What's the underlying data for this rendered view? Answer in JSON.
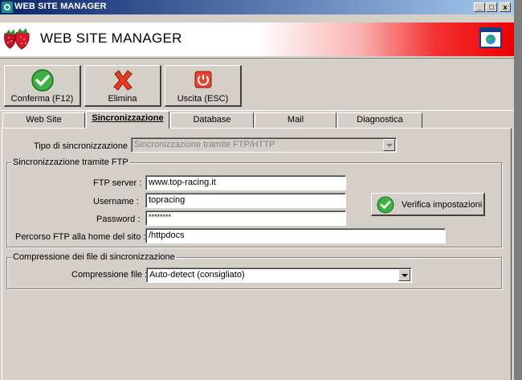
{
  "window": {
    "title": "WEB SITE MANAGER",
    "min_glyph": "_",
    "max_glyph": "□",
    "close_glyph": "x"
  },
  "header": {
    "title": "WEB SITE MANAGER"
  },
  "toolbar": {
    "confirm_label": "Conferma (F12)",
    "delete_label": "Elimina",
    "exit_label": "Uscita (ESC)"
  },
  "tabs": [
    {
      "label": "Web Site"
    },
    {
      "label": "Sincronizzazione"
    },
    {
      "label": "Database"
    },
    {
      "label": "Mail"
    },
    {
      "label": "Diagnostica"
    }
  ],
  "sync": {
    "type_label": "Tipo di sincronizzazione :",
    "type_value": "Sincronizzazione tramite FTP/HTTP"
  },
  "ftp_group": {
    "title": "Sincronizzazione tramite FTP",
    "server_label": "FTP server :",
    "server_value": "www.top-racing.it",
    "username_label": "Username :",
    "username_value": "topracing",
    "password_label": "Password :",
    "password_value": "********",
    "path_label": "Percorso FTP alla home del sito :",
    "path_value": "/httpdocs",
    "verify_label": "Verifica impostazioni"
  },
  "compression_group": {
    "title": "Compressione dei file di sincronizzazione",
    "label": "Compressione file :",
    "value": "Auto-detect (consigliato)"
  },
  "colors": {
    "title_bar_start": "#0a246a",
    "title_bar_end": "#a6caf0",
    "banner_red": "#ee0000",
    "face": "#d4d0c8"
  },
  "icons": {
    "app": "strawberry-icon",
    "confirm": "checkmark-icon",
    "delete": "red-x-icon",
    "exit": "power-icon",
    "verify": "checkmark-icon",
    "window": "window-icon"
  }
}
